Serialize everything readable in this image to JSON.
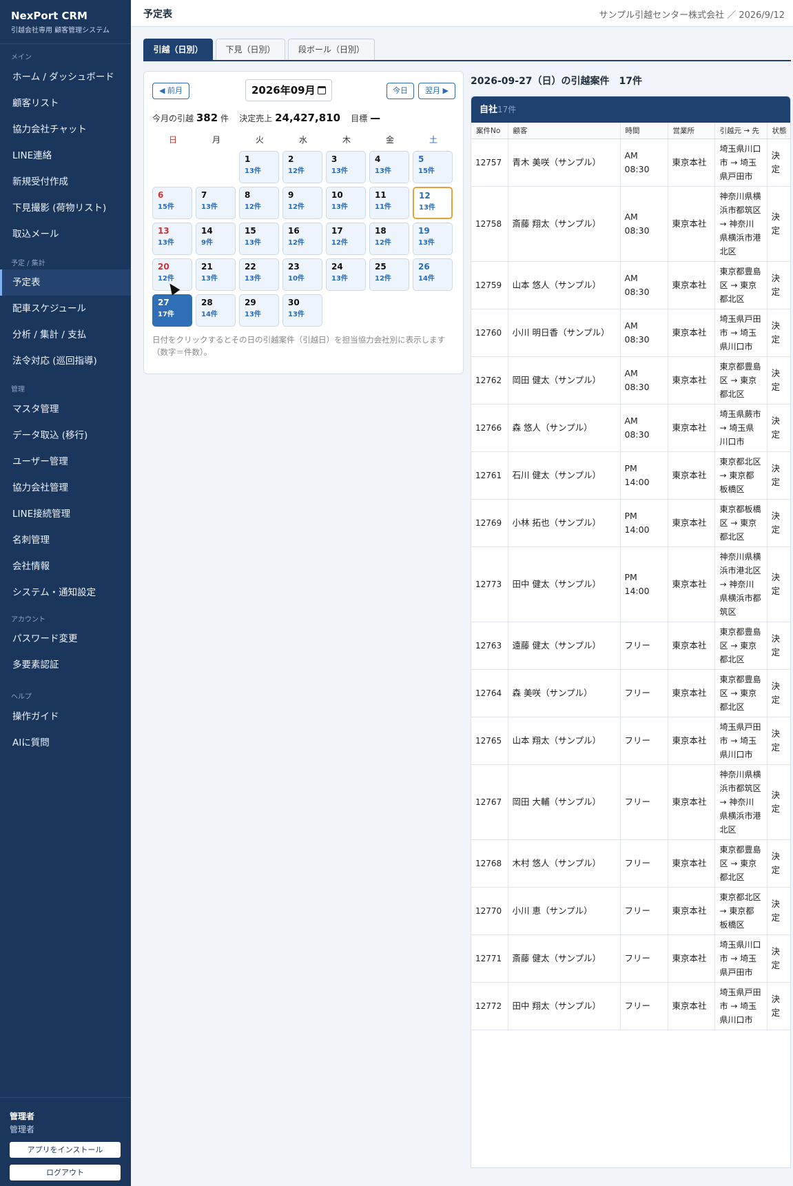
{
  "app": {
    "title": "NexPort CRM",
    "subtitle": "引越会社専用 顧客管理システム"
  },
  "sidebar": {
    "sections": [
      {
        "label": "メイン",
        "items": [
          "ホーム / ダッシュボード",
          "顧客リスト",
          "協力会社チャット",
          "LINE連絡",
          "新規受付作成",
          "下見撮影 (荷物リスト)",
          "取込メール"
        ]
      },
      {
        "label": "予定 / 集計",
        "items": [
          "予定表",
          "配車スケジュール",
          "分析 / 集計 / 支払",
          "法令対応 (巡回指導)"
        ]
      },
      {
        "label": "管理",
        "items": [
          "マスタ管理",
          "データ取込 (移行)",
          "ユーザー管理",
          "協力会社管理",
          "LINE接続管理",
          "名刺管理",
          "会社情報",
          "システム・通知設定"
        ]
      },
      {
        "label": "アカウント",
        "items": [
          "パスワード変更",
          "多要素認証"
        ]
      },
      {
        "label": "ヘルプ",
        "items": [
          "操作ガイド",
          "AIに質問"
        ]
      }
    ],
    "active_item": "予定表",
    "user": {
      "name": "管理者",
      "role": "管理者"
    },
    "install_button": "アプリをインストール",
    "logout_button": "ログアウト"
  },
  "header": {
    "title": "予定表",
    "company_date": "サンプル引越センター株式会社 ／ 2026/9/12"
  },
  "tabs": [
    "引越（日別）",
    "下見（日別）",
    "段ボール（日別）"
  ],
  "active_tab": 0,
  "calendar": {
    "prev_label": "◀ 前月",
    "today_label": "今日",
    "next_label": "翌月 ▶",
    "month_value": "2026年09月",
    "summary": {
      "moves_label": "今月の引越",
      "moves_value": "382",
      "moves_unit": "件",
      "sales_label": "決定売上",
      "sales_value": "24,427,810",
      "target_label": "目標",
      "target_value": "—"
    },
    "weekdays": [
      "日",
      "月",
      "火",
      "水",
      "木",
      "金",
      "土"
    ],
    "first_weekday_index": 2,
    "today_day": 12,
    "selected_day": 27,
    "days": [
      {
        "day": "1",
        "count": "13件"
      },
      {
        "day": "2",
        "count": "12件"
      },
      {
        "day": "3",
        "count": "13件"
      },
      {
        "day": "4",
        "count": "13件"
      },
      {
        "day": "5",
        "count": "15件"
      },
      {
        "day": "6",
        "count": "15件"
      },
      {
        "day": "7",
        "count": "13件"
      },
      {
        "day": "8",
        "count": "12件"
      },
      {
        "day": "9",
        "count": "12件"
      },
      {
        "day": "10",
        "count": "13件"
      },
      {
        "day": "11",
        "count": "11件"
      },
      {
        "day": "12",
        "count": "13件"
      },
      {
        "day": "13",
        "count": "13件"
      },
      {
        "day": "14",
        "count": "9件"
      },
      {
        "day": "15",
        "count": "13件"
      },
      {
        "day": "16",
        "count": "12件"
      },
      {
        "day": "17",
        "count": "12件"
      },
      {
        "day": "18",
        "count": "12件"
      },
      {
        "day": "19",
        "count": "13件"
      },
      {
        "day": "20",
        "count": "12件"
      },
      {
        "day": "21",
        "count": "13件"
      },
      {
        "day": "22",
        "count": "13件"
      },
      {
        "day": "23",
        "count": "10件"
      },
      {
        "day": "24",
        "count": "13件"
      },
      {
        "day": "25",
        "count": "12件"
      },
      {
        "day": "26",
        "count": "14件"
      },
      {
        "day": "27",
        "count": "17件"
      },
      {
        "day": "28",
        "count": "14件"
      },
      {
        "day": "29",
        "count": "13件"
      },
      {
        "day": "30",
        "count": "13件"
      }
    ],
    "note": "日付をクリックするとその日の引越案件（引越日）を担当協力会社別に表示します（数字＝件数）。"
  },
  "list": {
    "title": "2026-09-27（日）の引越案件　17件",
    "group": {
      "name": "自社",
      "count": "17件"
    },
    "columns": [
      "案件No",
      "顧客",
      "時間",
      "営業所",
      "引越元 → 先",
      "状態"
    ],
    "rows": [
      {
        "no": "12757",
        "customer": "青木 美咲（サンプル）",
        "time": "AM 08:30",
        "office": "東京本社",
        "route": "埼玉県川口市 → 埼玉県戸田市",
        "status": "決定"
      },
      {
        "no": "12758",
        "customer": "斎藤 翔太（サンプル）",
        "time": "AM 08:30",
        "office": "東京本社",
        "route": "神奈川県横浜市都筑区 → 神奈川県横浜市港北区",
        "status": "決定"
      },
      {
        "no": "12759",
        "customer": "山本 悠人（サンプル）",
        "time": "AM 08:30",
        "office": "東京本社",
        "route": "東京都豊島区 → 東京都北区",
        "status": "決定"
      },
      {
        "no": "12760",
        "customer": "小川 明日香（サンプル）",
        "time": "AM 08:30",
        "office": "東京本社",
        "route": "埼玉県戸田市 → 埼玉県川口市",
        "status": "決定"
      },
      {
        "no": "12762",
        "customer": "岡田 健太（サンプル）",
        "time": "AM 08:30",
        "office": "東京本社",
        "route": "東京都豊島区 → 東京都北区",
        "status": "決定"
      },
      {
        "no": "12766",
        "customer": "森 悠人（サンプル）",
        "time": "AM 08:30",
        "office": "東京本社",
        "route": "埼玉県蕨市 → 埼玉県川口市",
        "status": "決定"
      },
      {
        "no": "12761",
        "customer": "石川 健太（サンプル）",
        "time": "PM 14:00",
        "office": "東京本社",
        "route": "東京都北区 → 東京都板橋区",
        "status": "決定"
      },
      {
        "no": "12769",
        "customer": "小林 拓也（サンプル）",
        "time": "PM 14:00",
        "office": "東京本社",
        "route": "東京都板橋区 → 東京都北区",
        "status": "決定"
      },
      {
        "no": "12773",
        "customer": "田中 健太（サンプル）",
        "time": "PM 14:00",
        "office": "東京本社",
        "route": "神奈川県横浜市港北区 → 神奈川県横浜市都筑区",
        "status": "決定"
      },
      {
        "no": "12763",
        "customer": "遠藤 健太（サンプル）",
        "time": "フリー",
        "office": "東京本社",
        "route": "東京都豊島区 → 東京都北区",
        "status": "決定"
      },
      {
        "no": "12764",
        "customer": "森 美咲（サンプル）",
        "time": "フリー",
        "office": "東京本社",
        "route": "東京都豊島区 → 東京都北区",
        "status": "決定"
      },
      {
        "no": "12765",
        "customer": "山本 翔太（サンプル）",
        "time": "フリー",
        "office": "東京本社",
        "route": "埼玉県戸田市 → 埼玉県川口市",
        "status": "決定"
      },
      {
        "no": "12767",
        "customer": "岡田 大輔（サンプル）",
        "time": "フリー",
        "office": "東京本社",
        "route": "神奈川県横浜市都筑区 → 神奈川県横浜市港北区",
        "status": "決定"
      },
      {
        "no": "12768",
        "customer": "木村 悠人（サンプル）",
        "time": "フリー",
        "office": "東京本社",
        "route": "東京都豊島区 → 東京都北区",
        "status": "決定"
      },
      {
        "no": "12770",
        "customer": "小川 恵（サンプル）",
        "time": "フリー",
        "office": "東京本社",
        "route": "東京都北区 → 東京都板橋区",
        "status": "決定"
      },
      {
        "no": "12771",
        "customer": "斎藤 健太（サンプル）",
        "time": "フリー",
        "office": "東京本社",
        "route": "埼玉県川口市 → 埼玉県戸田市",
        "status": "決定"
      },
      {
        "no": "12772",
        "customer": "田中 翔太（サンプル）",
        "time": "フリー",
        "office": "東京本社",
        "route": "埼玉県戸田市 → 埼玉県川口市",
        "status": "決定"
      }
    ]
  }
}
